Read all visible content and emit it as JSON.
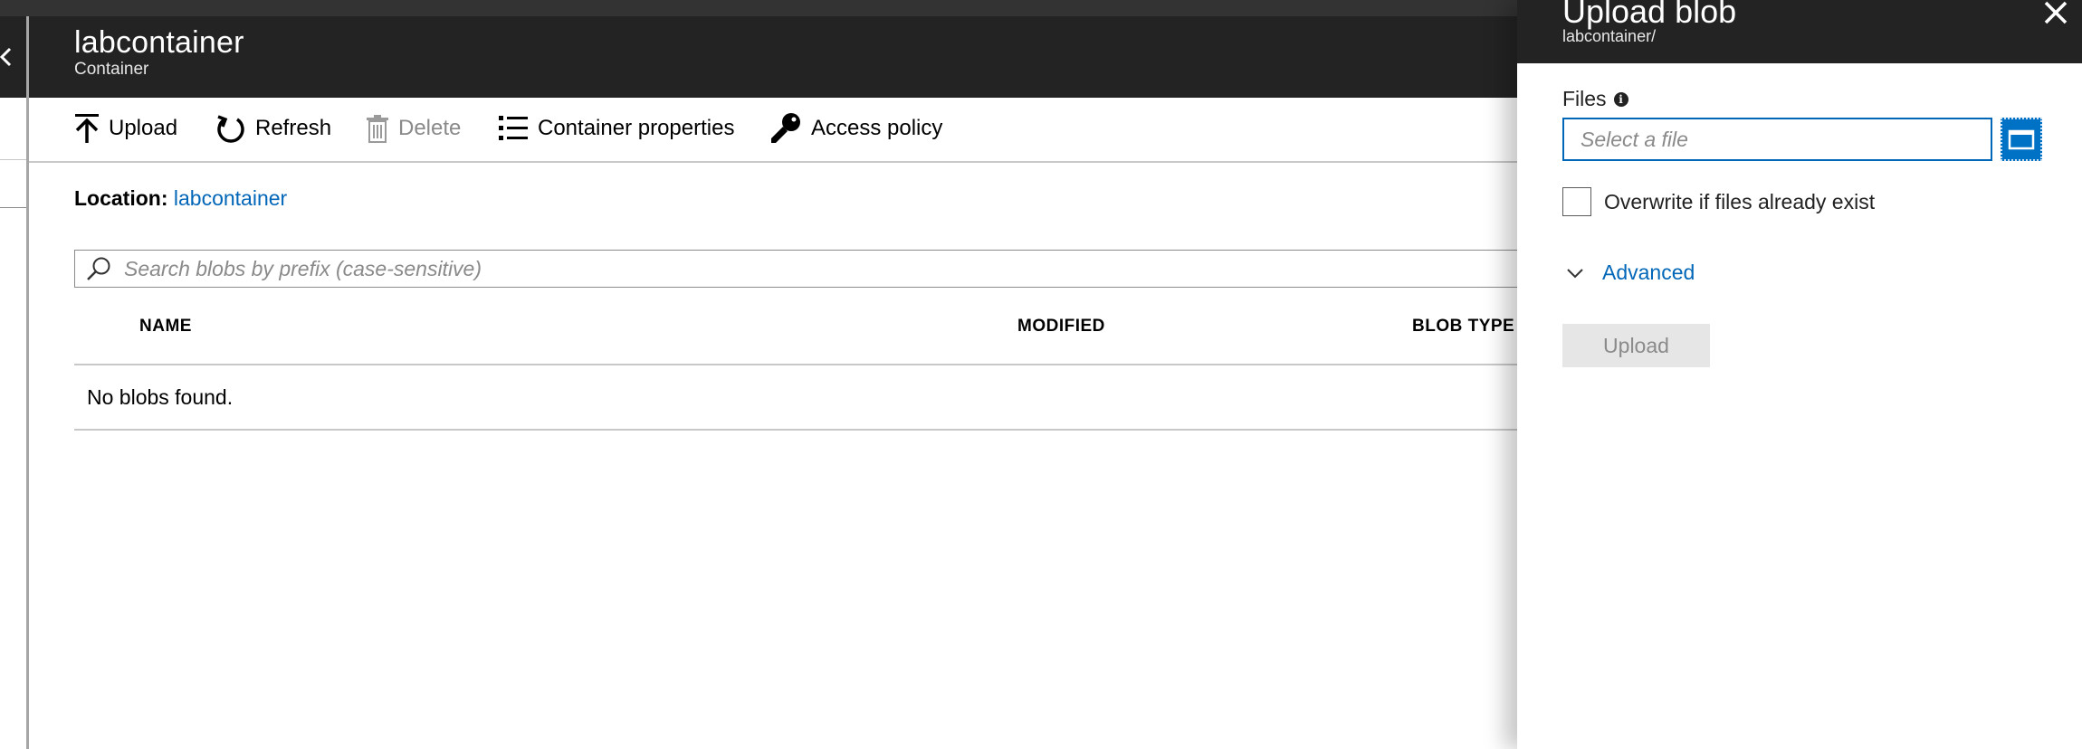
{
  "blade": {
    "title": "labcontainer",
    "subtitle": "Container"
  },
  "toolbar": {
    "upload": "Upload",
    "refresh": "Refresh",
    "delete": "Delete",
    "container_properties": "Container properties",
    "access_policy": "Access policy"
  },
  "location": {
    "label": "Location:",
    "value": "labcontainer"
  },
  "search": {
    "placeholder": "Search blobs by prefix (case-sensitive)"
  },
  "table": {
    "columns": [
      "NAME",
      "MODIFIED",
      "BLOB TYPE"
    ],
    "empty_message": "No blobs found."
  },
  "upload_panel": {
    "title": "Upload blob",
    "subtitle": "labcontainer/",
    "files_label": "Files",
    "file_placeholder": "Select a file",
    "overwrite_label": "Overwrite if files already exist",
    "overwrite_checked": false,
    "advanced_label": "Advanced",
    "upload_button": "Upload"
  },
  "colors": {
    "header_bg": "#232323",
    "accent": "#0066b8",
    "browse_button": "#0072c6",
    "disabled_text": "#8a8a8a"
  }
}
